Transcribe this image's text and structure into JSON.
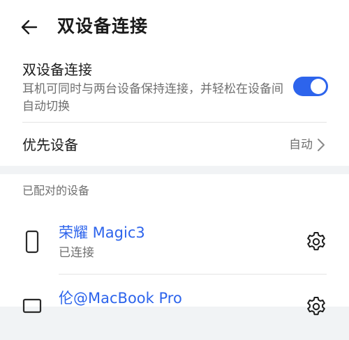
{
  "header": {
    "title": "双设备连接"
  },
  "dual_connection": {
    "title": "双设备连接",
    "description": "耳机可同时与两台设备保持连接，并轻松在设备间自动切换",
    "enabled": true
  },
  "priority_device": {
    "label": "优先设备",
    "value": "自动"
  },
  "paired_section": {
    "title": "已配对的设备",
    "devices": [
      {
        "name": "荣耀 Magic3",
        "status": "已连接",
        "icon": "phone-icon"
      },
      {
        "name": "伦@MacBook Pro",
        "status": "",
        "icon": "laptop-icon"
      }
    ]
  },
  "colors": {
    "accent": "#2d64ec",
    "background": "#f1f3f5",
    "card": "#ffffff",
    "secondary_text": "#6f6f6f"
  }
}
